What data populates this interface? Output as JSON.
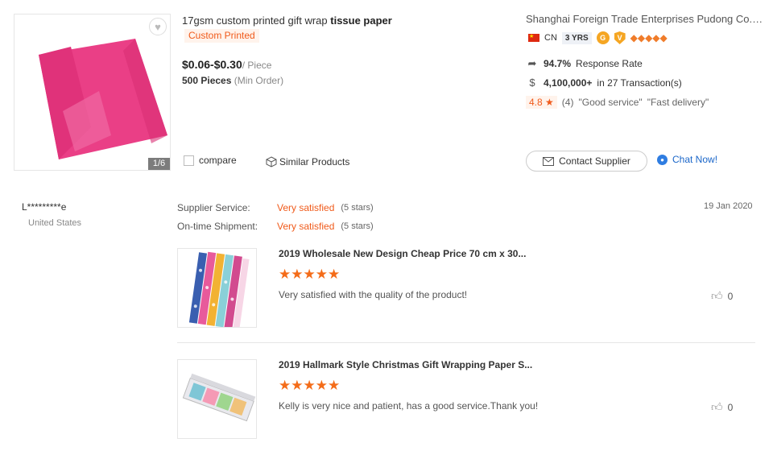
{
  "product": {
    "title_prefix": "17gsm custom printed gift wrap ",
    "title_bold": "tissue paper",
    "tag": "Custom Printed",
    "price": "$0.06-$0.30",
    "price_unit": "/ Piece",
    "moq": "500 Pieces",
    "moq_note": "(Min Order)",
    "image_pager": "1/6",
    "compare_label": "compare",
    "similar_label": "Similar Products",
    "favorite_icon": "heart-icon"
  },
  "supplier": {
    "name": "Shanghai Foreign Trade Enterprises Pudong Co., Ltd.",
    "country": "CN",
    "years": "3 YRS",
    "response_rate": "94.7%",
    "response_label": "Response Rate",
    "transactions_amount": "4,100,000+",
    "transactions_text": "in 27 Transaction(s)",
    "rating": "4.8",
    "review_count": "(4)",
    "quote1": "\"Good service\"",
    "quote2": "\"Fast delivery\"",
    "contact_label": "Contact Supplier",
    "chat_label": "Chat Now!",
    "brand_color": "#f05a1a",
    "link_color": "#1a66c9"
  },
  "review": {
    "reviewer": "L*********e",
    "country": "United States",
    "date": "19 Jan 2020",
    "supplier_service_label": "Supplier Service:",
    "supplier_service_value": "Very satisfied",
    "supplier_service_stars": "(5 stars)",
    "shipment_label": "On-time Shipment:",
    "shipment_value": "Very satisfied",
    "shipment_stars": "(5 stars)",
    "items": [
      {
        "title": "2019 Wholesale New Design Cheap Price 70 cm x 30...",
        "stars": "★★★★★",
        "comment": "Very satisfied with the quality of the product!",
        "likes": "0"
      },
      {
        "title": "2019 Hallmark Style Christmas Gift Wrapping Paper S...",
        "stars": "★★★★★",
        "comment": "Kelly is very nice and patient, has a good service.Thank you!",
        "likes": "0"
      }
    ]
  }
}
